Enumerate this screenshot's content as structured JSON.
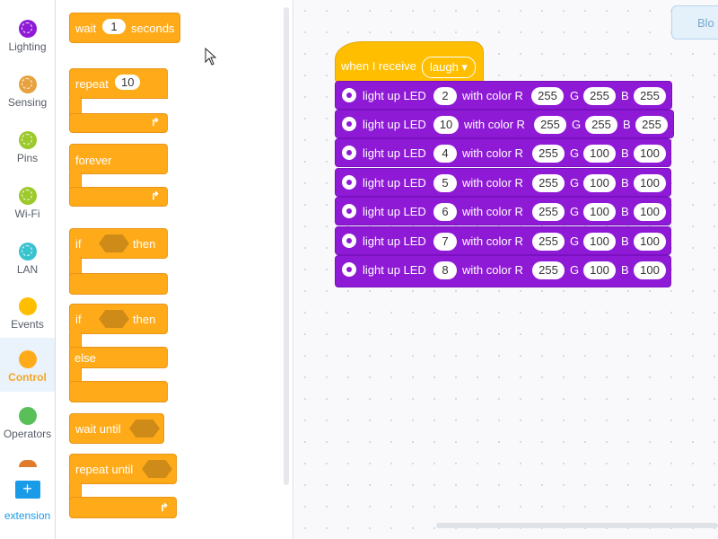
{
  "categories": [
    {
      "label": "Lighting",
      "color": "#8f1ad6",
      "icon": "lighting-icon"
    },
    {
      "label": "Sensing",
      "color": "#e7a23f",
      "icon": "sensing-icon"
    },
    {
      "label": "Pins",
      "color": "#9cc92c",
      "icon": "pins-icon"
    },
    {
      "label": "Wi-Fi",
      "color": "#9cc92c",
      "icon": "wifi-icon"
    },
    {
      "label": "LAN",
      "color": "#39c3cf",
      "icon": "lan-icon"
    },
    {
      "label": "Events",
      "color": "#ffbf00",
      "icon": "events-icon"
    },
    {
      "label": "Control",
      "color": "#ffab19",
      "icon": "control-icon"
    },
    {
      "label": "Operators",
      "color": "#59c059",
      "icon": "operators-icon"
    }
  ],
  "extension": {
    "label": "extension",
    "icon": "plus-icon"
  },
  "palette": {
    "wait": {
      "label": "wait",
      "value": "1",
      "unit": "seconds"
    },
    "repeat": {
      "label": "repeat",
      "value": "10"
    },
    "forever": {
      "label": "forever"
    },
    "if_then": {
      "if": "if",
      "then": "then"
    },
    "if_else": {
      "if": "if",
      "then": "then",
      "else": "else"
    },
    "wait_until": {
      "label": "wait until"
    },
    "repeat_until": {
      "label": "repeat until"
    }
  },
  "workspace": {
    "tab_label": "Blo",
    "hat": {
      "label": "when I receive",
      "message": "laugh ▾"
    },
    "led_blocks": [
      {
        "led": "2",
        "r": "255",
        "g": "255",
        "b": "255"
      },
      {
        "led": "10",
        "r": "255",
        "g": "255",
        "b": "255"
      },
      {
        "led": "4",
        "r": "255",
        "g": "100",
        "b": "100"
      },
      {
        "led": "5",
        "r": "255",
        "g": "100",
        "b": "100"
      },
      {
        "led": "6",
        "r": "255",
        "g": "100",
        "b": "100"
      },
      {
        "led": "7",
        "r": "255",
        "g": "100",
        "b": "100"
      },
      {
        "led": "8",
        "r": "255",
        "g": "100",
        "b": "100"
      }
    ],
    "led_text": {
      "prefix": "light up LED",
      "with_color": "with color R",
      "g": "G",
      "b": "B"
    }
  },
  "colors": {
    "control": "#ffab19",
    "events": "#ffbf00",
    "lighting": "#8f1ad6",
    "active_bg": "#eaf2fb"
  }
}
